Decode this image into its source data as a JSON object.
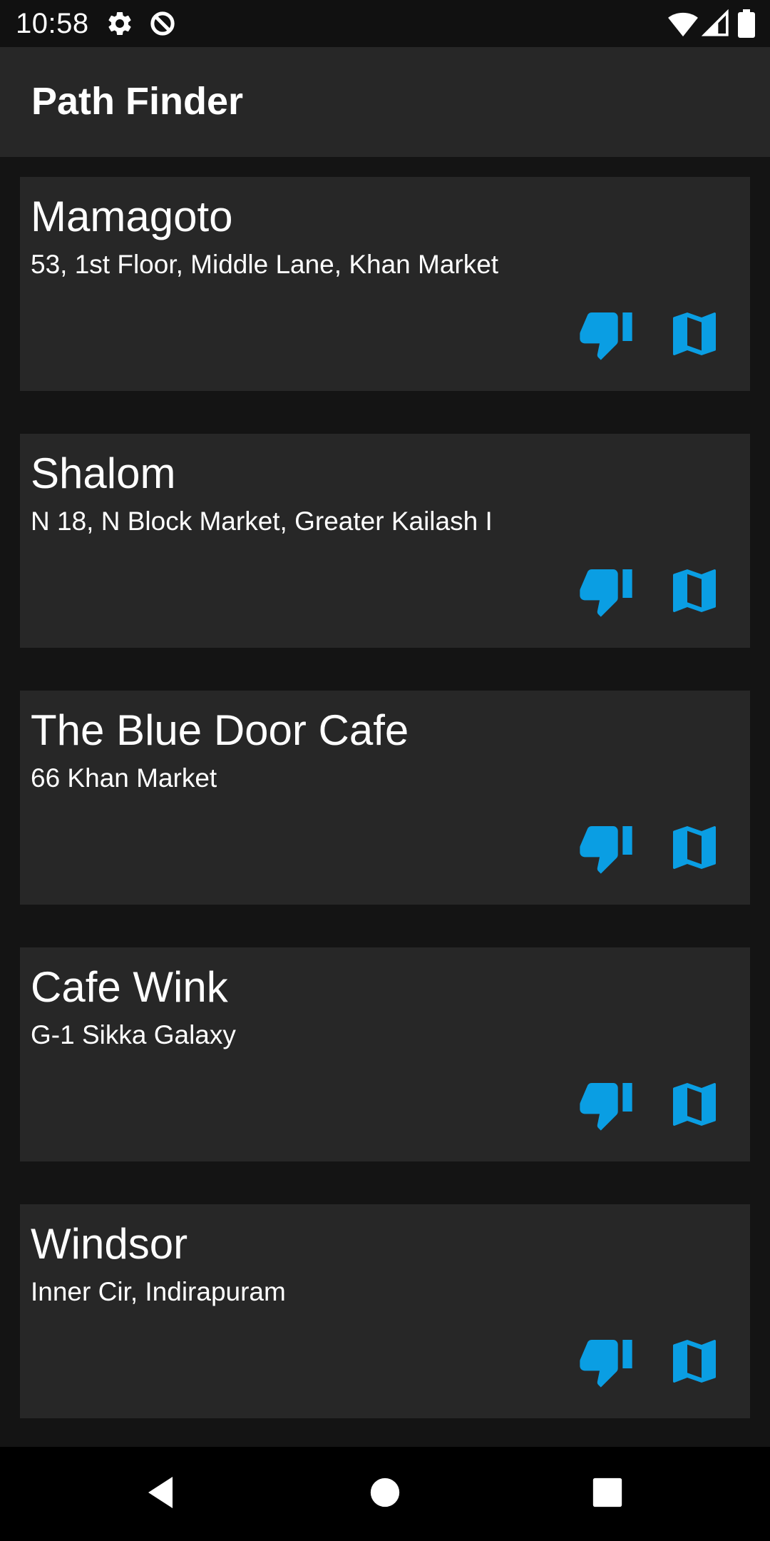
{
  "status_bar": {
    "time": "10:58",
    "icons": [
      "settings-icon",
      "data-saver-icon",
      "wifi-icon",
      "signal-icon",
      "battery-icon"
    ]
  },
  "app_bar": {
    "title": "Path Finder"
  },
  "places": [
    {
      "name": "Mamagoto",
      "address": "53, 1st Floor, Middle Lane, Khan Market"
    },
    {
      "name": "Shalom",
      "address": "N 18, N Block Market, Greater Kailash I"
    },
    {
      "name": "The Blue Door Cafe",
      "address": "66 Khan Market"
    },
    {
      "name": "Cafe Wink",
      "address": "G-1 Sikka Galaxy"
    },
    {
      "name": "Windsor",
      "address": "Inner Cir, Indirapuram"
    }
  ],
  "card_actions": [
    "thumb-down-icon",
    "map-icon"
  ],
  "nav_bar": {
    "buttons": [
      "back-icon",
      "home-icon",
      "recents-icon"
    ]
  },
  "colors": {
    "accent": "#0a9ee3",
    "background": "#141414",
    "surface": "#272727",
    "status_bar": "#111111",
    "text": "#ffffff"
  }
}
